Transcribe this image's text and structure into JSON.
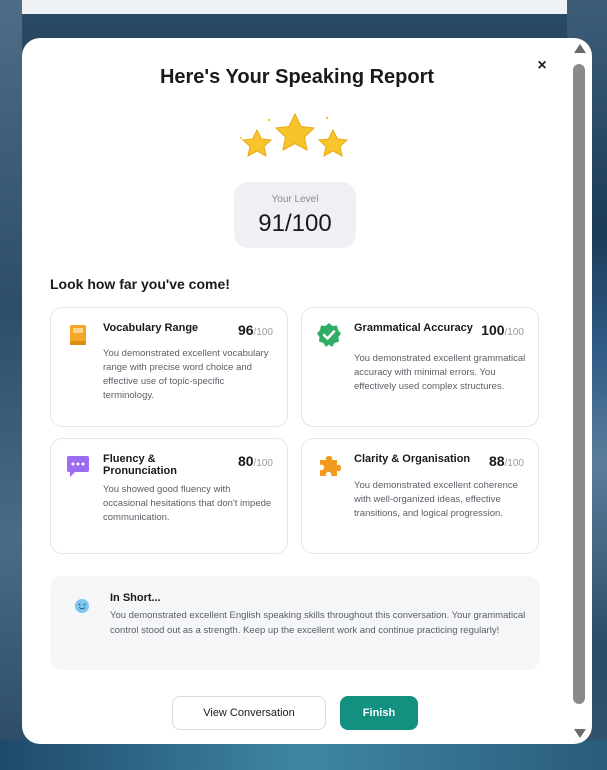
{
  "modal": {
    "title": "Here's Your Speaking Report",
    "close_glyph": "×",
    "rating_stars": 3
  },
  "level": {
    "label": "Your Level",
    "value": "91/100"
  },
  "section_heading": "Look how far you've come!",
  "cards": [
    {
      "title": "Vocabulary Range",
      "score": "96",
      "out_of": "/100",
      "icon": "book-icon",
      "icon_color": "#f4a62a",
      "description": "You demonstrated excellent vocabulary range with precise word choice and effective use of topic-specific terminology."
    },
    {
      "title": "Grammatical Accuracy",
      "score": "100",
      "out_of": "/100",
      "icon": "check-badge-icon",
      "icon_color": "#2fae63",
      "description": "You demonstrated excellent grammatical accuracy with minimal errors. You effectively used complex structures."
    },
    {
      "title": "Fluency & Pronunciation",
      "score": "80",
      "out_of": "/100",
      "icon": "chat-bubble-icon",
      "icon_color": "#9b6bf2",
      "description": "You showed good fluency with occasional hesitations that don't impede communication."
    },
    {
      "title": "Clarity & Organisation",
      "score": "88",
      "out_of": "/100",
      "icon": "puzzle-icon",
      "icon_color": "#f29a1f",
      "description": "You demonstrated excellent coherence with well-organized ideas, effective transitions, and logical progression."
    }
  ],
  "summary": {
    "title": "In Short...",
    "icon": "smiley-icon",
    "text": "You demonstrated excellent English speaking skills throughout this conversation. Your grammatical control stood out as a strength. Keep up the excellent work and continue practicing regularly!"
  },
  "buttons": {
    "view_conversation": "View Conversation",
    "finish": "Finish"
  },
  "colors": {
    "primary": "#13907f",
    "star": "#f7c52b"
  }
}
